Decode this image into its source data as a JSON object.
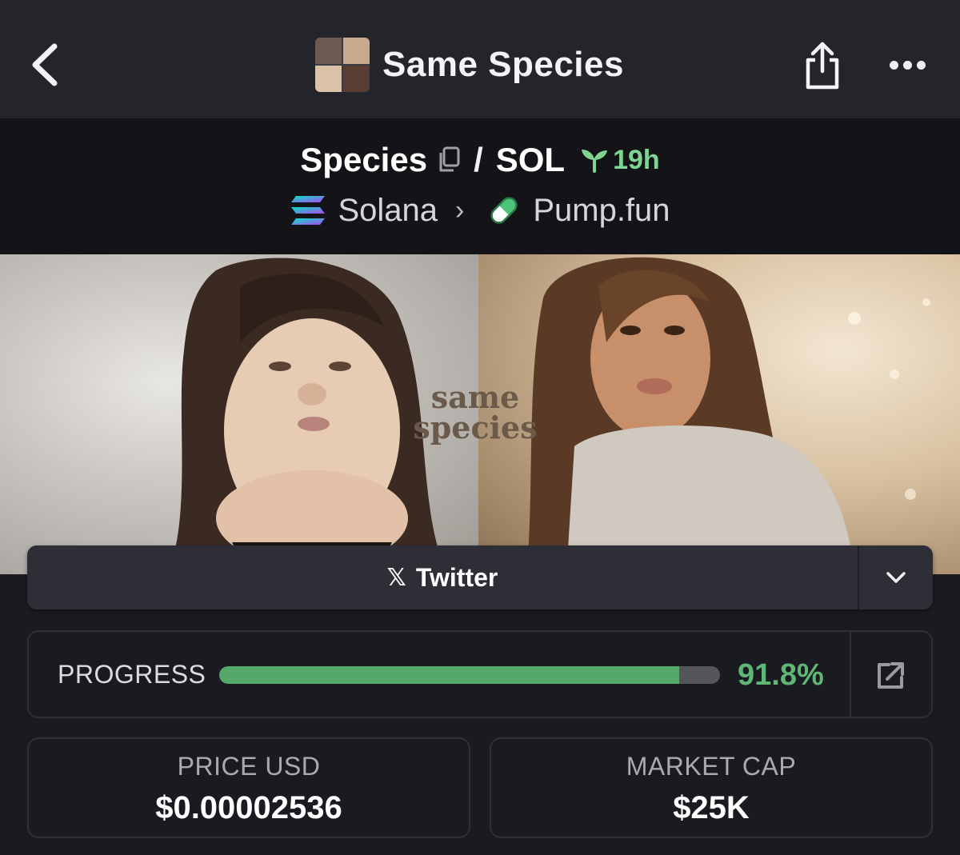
{
  "header": {
    "title": "Same Species",
    "back_icon": "chevron-left-icon",
    "share_icon": "share-icon",
    "more_icon": "more-horizontal-icon"
  },
  "token": {
    "symbol": "Species",
    "separator": "/",
    "quote": "SOL",
    "age": "19h",
    "chain": "Solana",
    "dex": "Pump.fun"
  },
  "banner": {
    "caption_line1": "same",
    "caption_line2": "species"
  },
  "social": {
    "twitter_label": "Twitter",
    "twitter_icon": "𝕏"
  },
  "progress": {
    "label": "PROGRESS",
    "value_text": "91.8%",
    "fraction": 0.918
  },
  "stats": {
    "price_label": "PRICE USD",
    "price_value": "$0.00002536",
    "mcap_label": "MARKET CAP",
    "mcap_value": "$25K"
  },
  "colors": {
    "accent_green": "#5fb776",
    "progress_fill": "#54a86a",
    "age_green": "#7ed491"
  }
}
